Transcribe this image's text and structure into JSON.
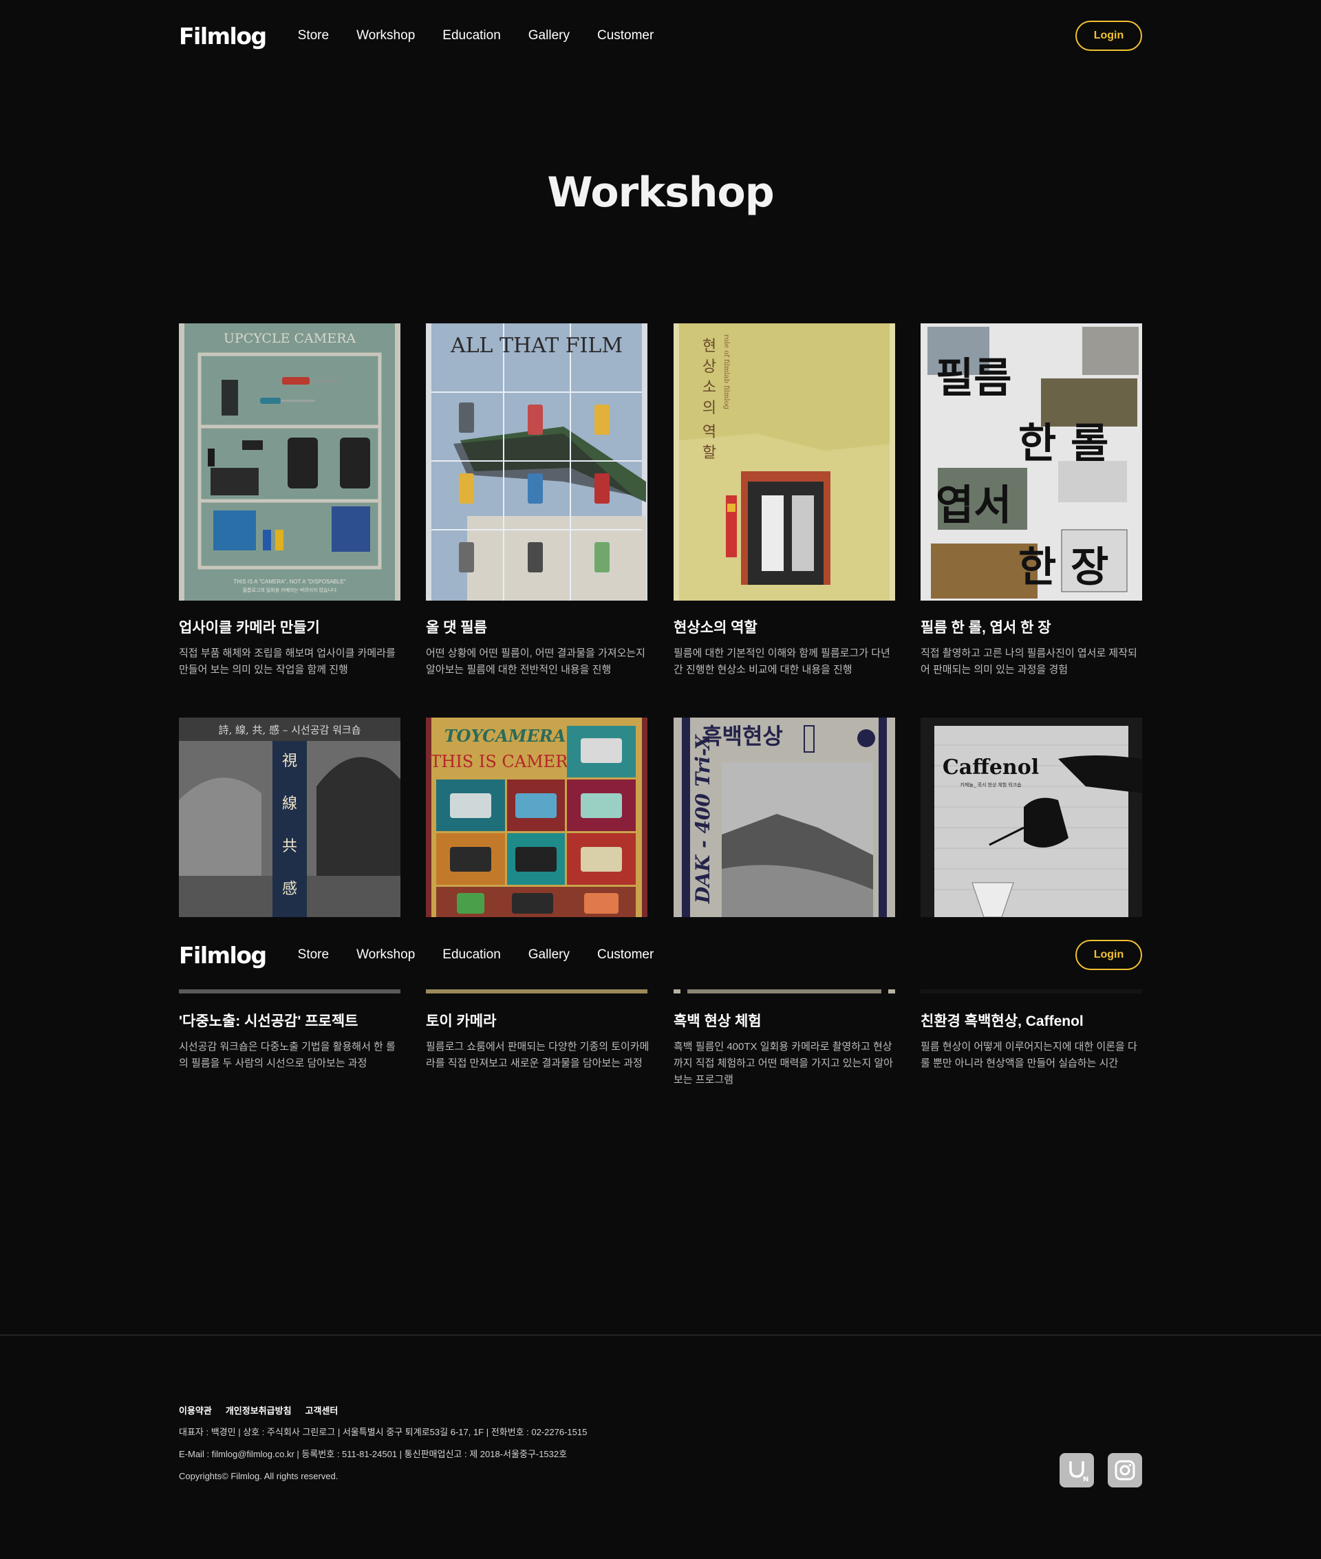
{
  "header": {
    "logo": "Filmlog",
    "nav": [
      "Store",
      "Workshop",
      "Education",
      "Gallery",
      "Customer"
    ],
    "login_label": "Login"
  },
  "page_title": "Workshop",
  "cards": [
    {
      "title": "업사이클 카메라 만들기",
      "desc": "직접 부품 해체와 조립을 해보며 업사이클 카메라를 만들어 보는 의미 있는 작업을 함께 진행",
      "poster_text": "UPCYCLE CAMERA",
      "poster_note": "THIS IS A \"CAMERA\", NOT A \"DISPOSABLE\"",
      "poster_note2": "필름로그의 일회용 카메라는 버려지지 않습니다"
    },
    {
      "title": "올 댓 필름",
      "desc": "어떤 상황에 어떤 필름이, 어떤 결과물을 가져오는지 알아보는 필름에 대한 전반적인 내용을 진행",
      "poster_text": "ALL THAT FILM"
    },
    {
      "title": "현상소의 역할",
      "desc": "필름에 대한 기본적인 이해와 함께 필름로그가 다년간 진행한 현상소 비교에 대한 내용을 진행",
      "poster_text": "현상소의 역할",
      "poster_sub": "role of filmlab filmlog"
    },
    {
      "title": "필름 한 롤, 엽서 한 장",
      "desc": "직접 촬영하고 고른 나의 필름사진이 엽서로 제작되어 판매되는 의미 있는 과정을 경험",
      "poster_words": [
        "필름",
        "한 롤",
        "엽서",
        "한 장"
      ]
    },
    {
      "title": "'다중노출: 시선공감' 프로젝트",
      "desc": "시선공감 워크숍은 다중노출 기법을 활용해서 한 롤의 필름을 두 사람의 시선으로 담아보는 과정",
      "poster_text": "詩, 線, 共, 感 – 시선공감 워크숍",
      "poster_chars": [
        "視",
        "線",
        "共",
        "感"
      ]
    },
    {
      "title": "토이 카메라",
      "desc": "필름로그 쇼룸에서 판매되는 다양한 기종의 토이카메라를 직접 만져보고 새로운 결과물을 담아보는 과정",
      "poster_text": "TOYCAMERA",
      "poster_text2": "THIS IS CAMERA"
    },
    {
      "title": "흑백 현상 체험",
      "desc": "흑백 필름인 400TX 일회용 카메라로 촬영하고 현상까지 직접 체험하고 어떤 매력을 가지고 있는지 알아보는 프로그램",
      "poster_text": "흑백현상",
      "poster_side": "DAK - 400 Tri-X"
    },
    {
      "title": "친환경 흑백현상, Caffenol",
      "desc": "필름 현상이 어떻게 이루어지는지에 대한 이론을 다룰 뿐만 아니라 현상액을 만들어 실습하는 시간",
      "poster_text": "Caffenol",
      "poster_sub": "카페놀_ 쿡서 현상 체험 워크숍"
    }
  ],
  "footer": {
    "links": [
      "이용약관",
      "개인정보취급방침",
      "고객센터"
    ],
    "info": [
      "대표자 : 백경민 | 상호 : 주식회사 그린로그 | 서울특별시 중구 퇴계로53길 6-17, 1F | 전화번호 : 02-2276-1515",
      "E-Mail : filmlog@filmlog.co.kr | 등록번호 : 511-81-24501 | 통신판매업신고 : 제 2018-서울중구-1532호",
      "Copyrights© Filmlog. All rights reserved."
    ],
    "social_icons": [
      "naver-store-icon",
      "instagram-icon"
    ]
  },
  "colors": {
    "accent": "#f2c230",
    "background": "#0b0b0c"
  }
}
